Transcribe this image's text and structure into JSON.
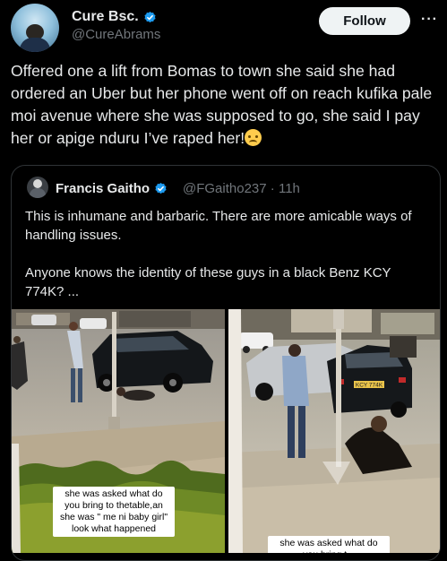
{
  "tweet": {
    "author_name": "Cure Bsc.",
    "author_handle": "@CureAbrams",
    "follow_label": "Follow",
    "more_label": "···",
    "text": "Offered one a lift from Bomas to town she said she had ordered an Uber but her phone went off on reach kufika pale moi avenue where she was supposed to go, she said I pay her or apige nduru I’ve raped her!"
  },
  "quote": {
    "author_name": "Francis Gaitho",
    "author_handle": "@FGaitho237",
    "timestamp": "· 11h",
    "paragraph_1": "This is inhumane and barbaric. There are more amicable ways of handling issues.",
    "paragraph_2": "Anyone knows the identity of these guys in a black Benz KCY 774K? ...",
    "media": {
      "left_caption": "she was asked what do you bring to thetable,an she was \" me ni baby girl\" look what happened",
      "right_caption": "she was asked what do you bring t...",
      "plate_text": "KCY 774K"
    }
  },
  "colors": {
    "background": "#000000",
    "text": "#e7e9ea",
    "secondary_text": "#71767b",
    "verified_blue": "#1d9bf0",
    "follow_bg": "#eff3f4",
    "border": "#2f3336"
  },
  "icons": {
    "verified": "verified-badge-icon",
    "emoji": "sad-tear-emoji-icon"
  }
}
